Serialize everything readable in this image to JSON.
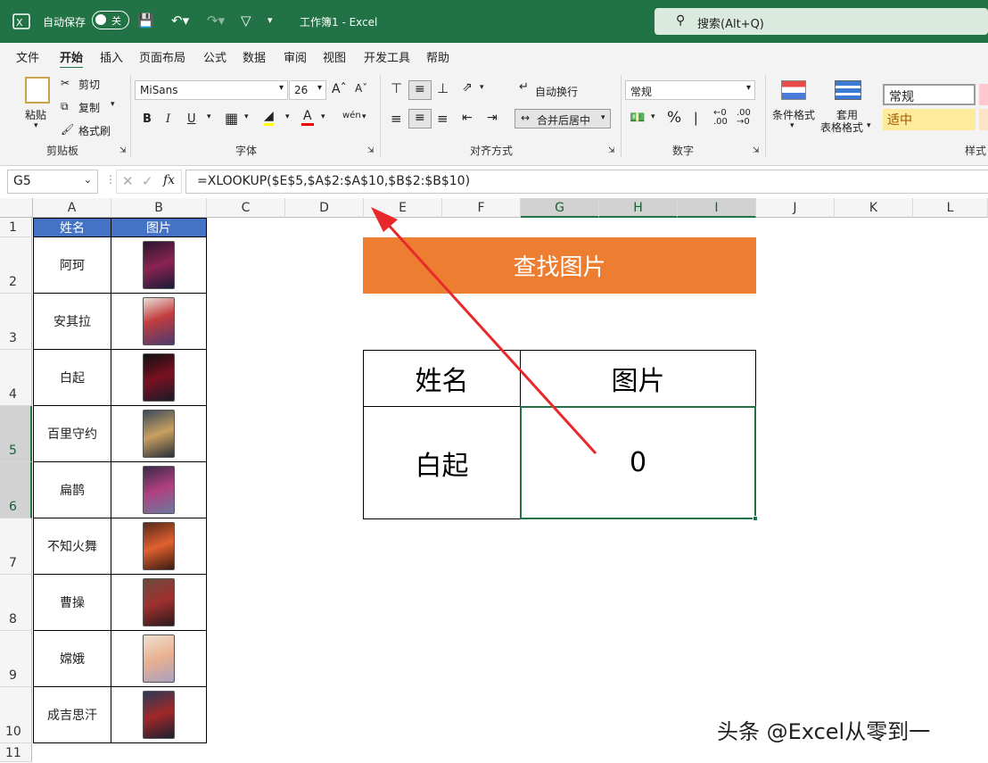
{
  "titlebar": {
    "autosave_label": "自动保存",
    "toggle_state": "关",
    "doc_title": "工作簿1  -  Excel",
    "search_placeholder": "搜索(Alt+Q)"
  },
  "menu": {
    "tabs": [
      "文件",
      "开始",
      "插入",
      "页面布局",
      "公式",
      "数据",
      "审阅",
      "视图",
      "开发工具",
      "帮助"
    ],
    "active": "开始"
  },
  "ribbon": {
    "clipboard": {
      "paste": "粘贴",
      "cut": "剪切",
      "copy": "复制",
      "format_painter": "格式刷",
      "group": "剪贴板"
    },
    "font": {
      "name": "MiSans",
      "size": "26",
      "bold": "B",
      "italic": "I",
      "underline": "U",
      "group": "字体"
    },
    "alignment": {
      "wrap": "自动换行",
      "merge": "合并后居中",
      "group": "对齐方式"
    },
    "number": {
      "format": "常规",
      "percent": "%",
      "group": "数字"
    },
    "styles": {
      "conditional": "条件格式",
      "table_line1": "套用",
      "table_line2": "表格格式",
      "normal": "常规",
      "neutral": "适中",
      "group": "样式"
    }
  },
  "formula_bar": {
    "name_box": "G5",
    "fx": "fx",
    "formula": "=XLOOKUP($E$5,$A$2:$A$10,$B$2:$B$10)"
  },
  "columns": [
    "A",
    "B",
    "C",
    "D",
    "E",
    "F",
    "G",
    "H",
    "I",
    "J",
    "K",
    "L"
  ],
  "rows": [
    "1",
    "2",
    "3",
    "4",
    "5",
    "6",
    "7",
    "8",
    "9",
    "10",
    "11"
  ],
  "table": {
    "header_name": "姓名",
    "header_pic": "图片",
    "names": [
      "阿珂",
      "安其拉",
      "白起",
      "百里守约",
      "扁鹊",
      "不知火舞",
      "曹操",
      "嫦娥",
      "成吉思汗"
    ]
  },
  "lookup": {
    "title": "查找图片",
    "col_name": "姓名",
    "col_pic": "图片",
    "name_value": "白起",
    "pic_value": "0"
  },
  "colors": {
    "excel_green": "#217346",
    "header_blue": "#4472c4",
    "banner_orange": "#ed7d31",
    "arrow_red": "#e8292b"
  },
  "watermark": "头条 @Excel从零到一"
}
